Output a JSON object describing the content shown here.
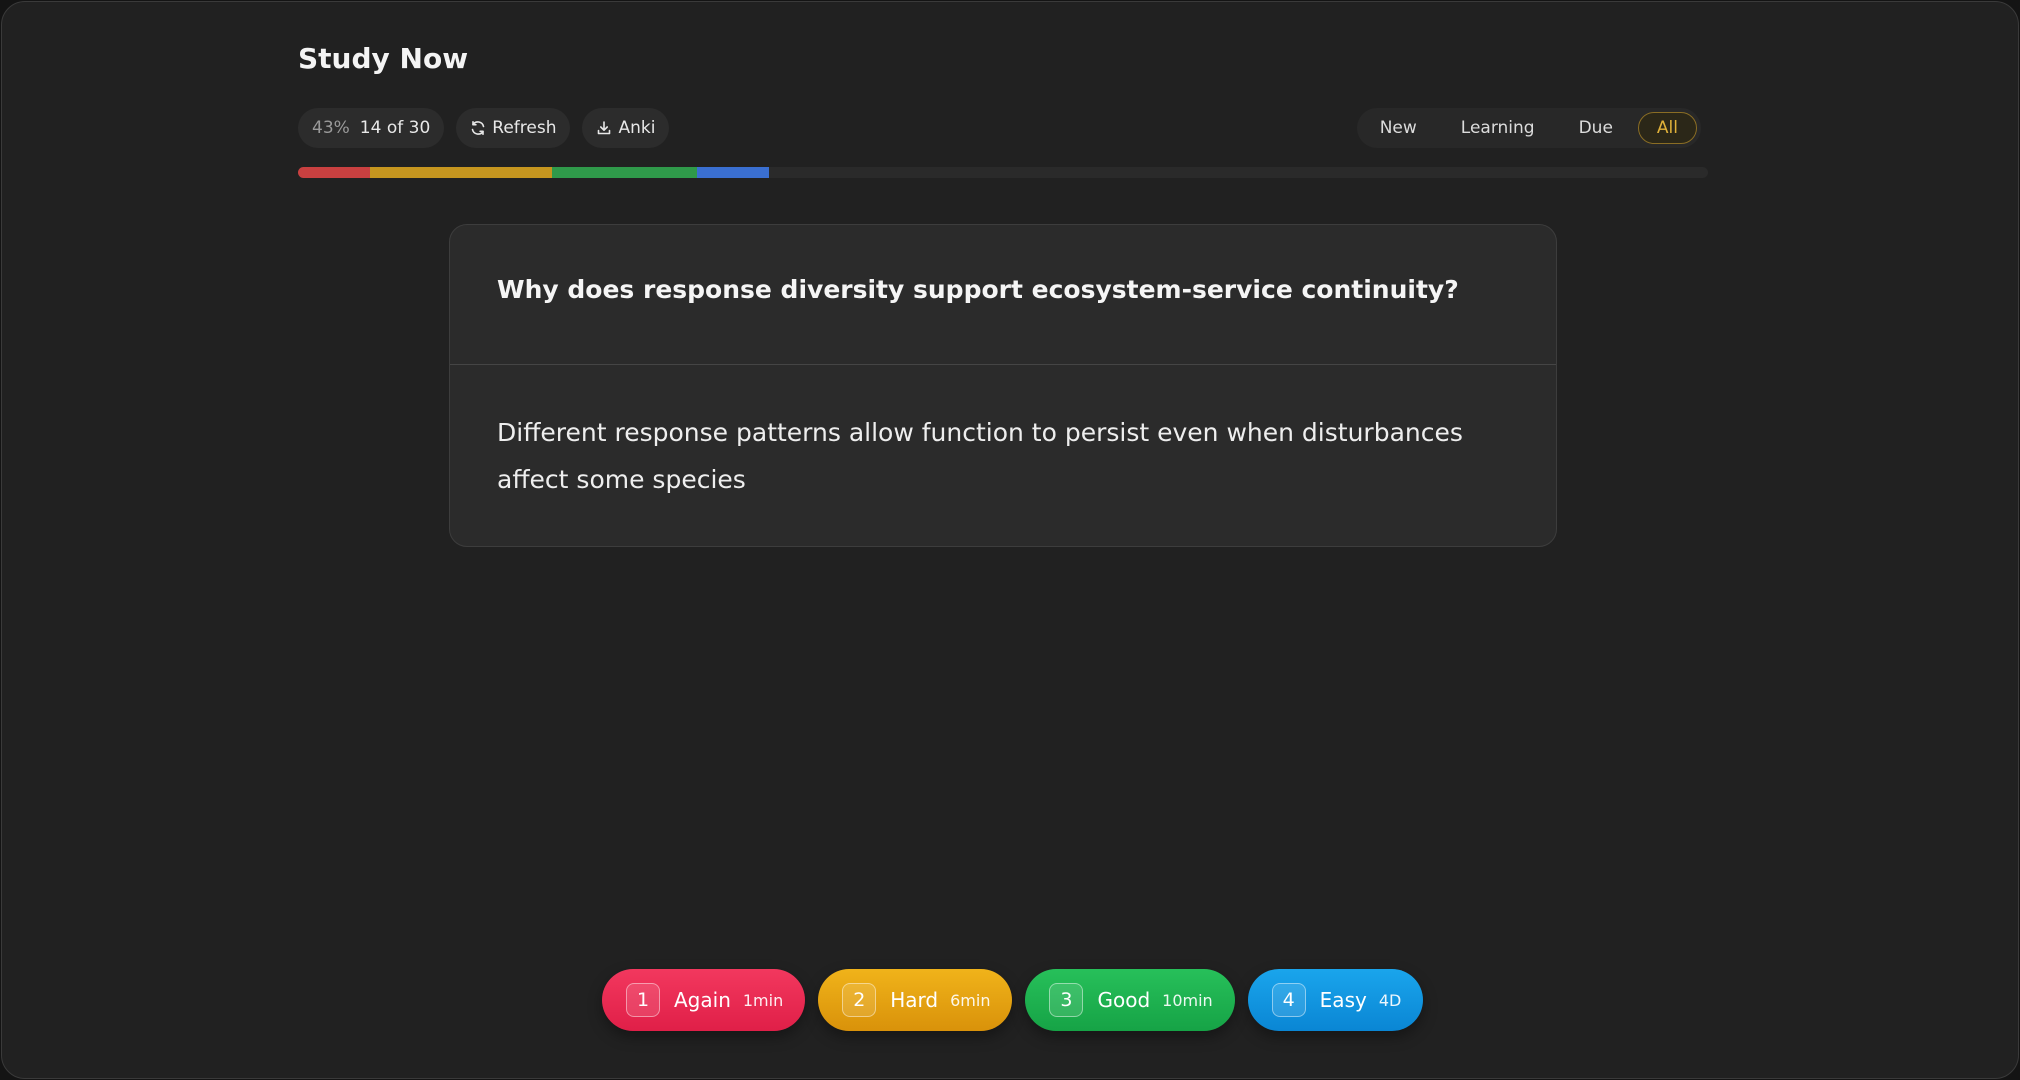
{
  "header": {
    "title": "Study Now"
  },
  "toolbar": {
    "progress_percent": "43%",
    "progress_count": "14 of 30",
    "refresh_label": "Refresh",
    "anki_label": "Anki"
  },
  "filters": [
    {
      "label": "New",
      "active": false
    },
    {
      "label": "Learning",
      "active": false
    },
    {
      "label": "Due",
      "active": false
    },
    {
      "label": "All",
      "active": true
    }
  ],
  "progress_bar": {
    "segments": [
      {
        "name": "again",
        "fraction": 0.051,
        "color": "#c94040"
      },
      {
        "name": "hard",
        "fraction": 0.129,
        "color": "#c6961f"
      },
      {
        "name": "good",
        "fraction": 0.103,
        "color": "#2f9a4a"
      },
      {
        "name": "easy",
        "fraction": 0.051,
        "color": "#3a6fd1"
      }
    ]
  },
  "card": {
    "question": "Why does response diversity support ecosystem-service continuity?",
    "answer": "Different response patterns allow function to persist even when disturbances affect some species"
  },
  "answer_buttons": [
    {
      "key": "1",
      "label": "Again",
      "interval": "1min",
      "colors": [
        "#f2385e",
        "#e01f48"
      ]
    },
    {
      "key": "2",
      "label": "Hard",
      "interval": "6min",
      "colors": [
        "#f0b31a",
        "#d9920a"
      ]
    },
    {
      "key": "3",
      "label": "Good",
      "interval": "10min",
      "colors": [
        "#27c05a",
        "#16a346"
      ]
    },
    {
      "key": "4",
      "label": "Easy",
      "interval": "4D",
      "colors": [
        "#1aa5ec",
        "#0a86d4"
      ]
    }
  ]
}
